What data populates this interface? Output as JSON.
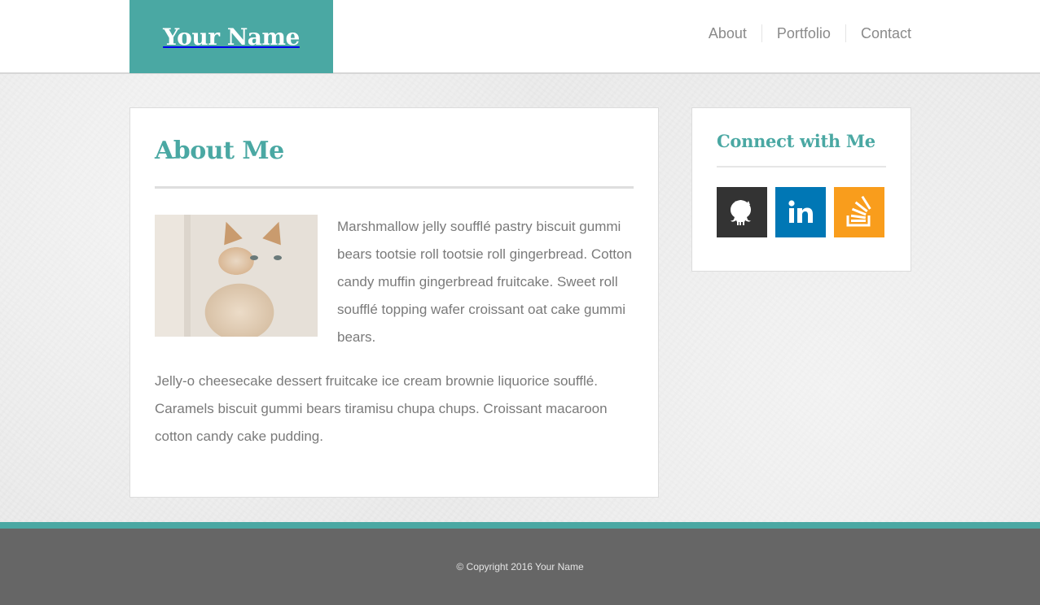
{
  "site": {
    "name": "Your Name"
  },
  "nav": {
    "items": [
      {
        "label": "About"
      },
      {
        "label": "Portfolio"
      },
      {
        "label": "Contact"
      }
    ]
  },
  "about": {
    "title": "About Me",
    "paragraph1": "Marshmallow jelly soufflé pastry biscuit gummi bears tootsie roll tootsie roll gingerbread. Cotton candy muffin gingerbread fruitcake. Sweet roll soufflé topping wafer croissant oat cake gummi bears.",
    "paragraph2": "Jelly-o cheesecake dessert fruitcake ice cream brownie liquorice soufflé. Caramels biscuit gummi bears tiramisu chupa chups. Croissant macaroon cotton candy cake pudding."
  },
  "sidebar": {
    "title": "Connect with Me",
    "social": [
      {
        "icon": "github-icon",
        "color": "#333333"
      },
      {
        "icon": "linkedin-icon",
        "color": "#0077b5"
      },
      {
        "icon": "stackoverflow-icon",
        "color": "#f99d1c"
      }
    ]
  },
  "footer": {
    "copyright": "© Copyright 2016 Your Name"
  },
  "colors": {
    "accent": "#4aa8a3",
    "footer": "#666666",
    "text": "#7a7a7a"
  }
}
